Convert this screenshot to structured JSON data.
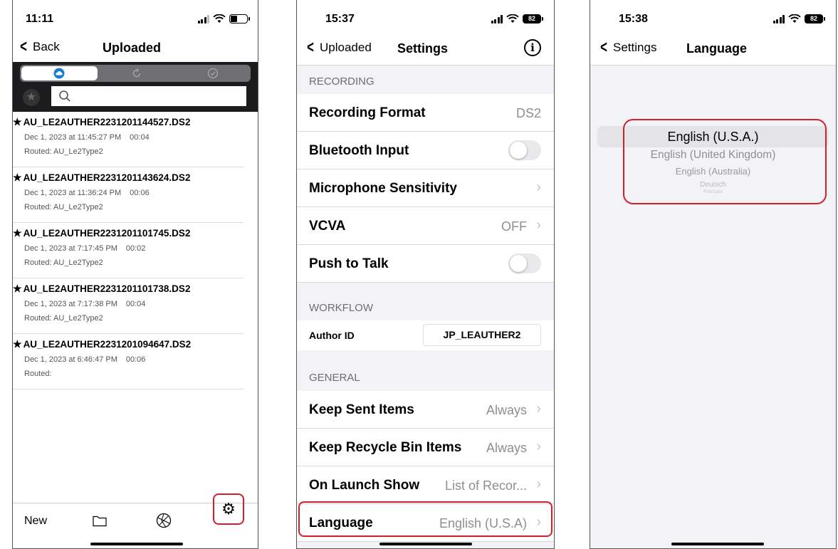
{
  "screen1": {
    "status": {
      "time": "11:11"
    },
    "nav": {
      "back_label": "Back",
      "title": "Uploaded"
    },
    "files": [
      {
        "name": "AU_LE2AUTHER2231201144527.DS2",
        "date": "Dec 1, 2023 at 11:45:27 PM",
        "duration": "00:04",
        "routed": "Routed: AU_Le2Type2"
      },
      {
        "name": "AU_LE2AUTHER2231201143624.DS2",
        "date": "Dec 1, 2023 at 11:36:24 PM",
        "duration": "00:06",
        "routed": "Routed: AU_Le2Type2"
      },
      {
        "name": "AU_LE2AUTHER2231201101745.DS2",
        "date": "Dec 1, 2023 at 7:17:45 PM",
        "duration": "00:02",
        "routed": "Routed: AU_Le2Type2"
      },
      {
        "name": "AU_LE2AUTHER2231201101738.DS2",
        "date": "Dec 1, 2023 at 7:17:38 PM",
        "duration": "00:04",
        "routed": "Routed: AU_Le2Type2"
      },
      {
        "name": "AU_LE2AUTHER2231201094647.DS2",
        "date": "Dec 1, 2023 at 6:46:47 PM",
        "duration": "00:06",
        "routed": "Routed:"
      }
    ],
    "tabbar": {
      "new_label": "New"
    },
    "icons": [
      "cloud-icon",
      "sync-icon",
      "check-circle-icon",
      "star-icon",
      "search-icon",
      "folder-icon",
      "globe-icon",
      "gear-icon"
    ]
  },
  "screen2": {
    "status": {
      "time": "15:37",
      "battery": "82"
    },
    "nav": {
      "back_label": "Uploaded",
      "title": "Settings"
    },
    "sections": {
      "recording": "RECORDING",
      "workflow": "WORKFLOW",
      "general": "GENERAL"
    },
    "recording_format": {
      "label": "Recording Format",
      "value": "DS2"
    },
    "bluetooth_input": {
      "label": "Bluetooth Input"
    },
    "mic_sensitivity": {
      "label": "Microphone Sensitivity"
    },
    "vcva": {
      "label": "VCVA",
      "value": "OFF"
    },
    "push_to_talk": {
      "label": "Push to Talk"
    },
    "author_id": {
      "label": "Author ID",
      "value": "JP_LEAUTHER2"
    },
    "keep_sent": {
      "label": "Keep Sent Items",
      "value": "Always"
    },
    "keep_recycle": {
      "label": "Keep Recycle Bin Items",
      "value": "Always"
    },
    "on_launch": {
      "label": "On Launch Show",
      "value": "List of Recor..."
    },
    "language": {
      "label": "Language",
      "value": "English (U.S.A)"
    }
  },
  "screen3": {
    "status": {
      "time": "15:38",
      "battery": "82"
    },
    "nav": {
      "back_label": "Settings",
      "title": "Language"
    },
    "options": [
      "English (U.S.A.)",
      "English (United Kingdom)",
      "English (Australia)",
      "Deutsch",
      "Français"
    ]
  },
  "colors": {
    "highlight": "#d21f2b",
    "group_bg": "#f2f2f7",
    "secondary_text": "#8e8e93"
  }
}
